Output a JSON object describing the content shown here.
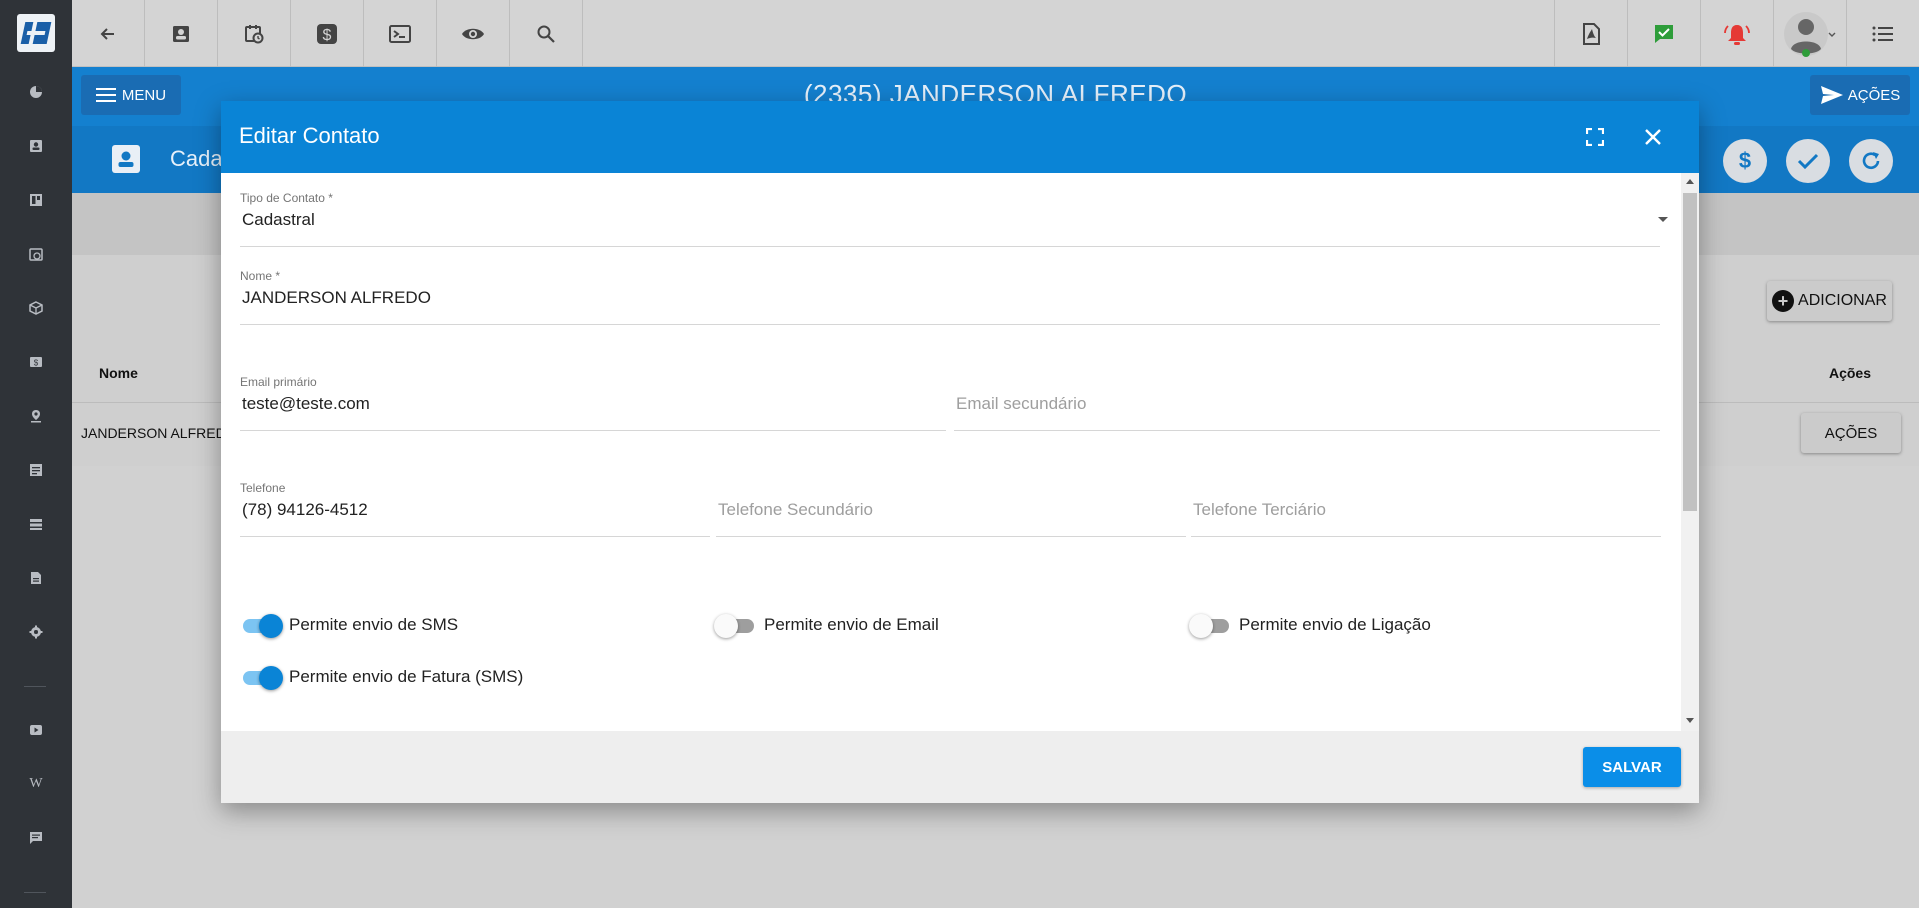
{
  "sidebar": {
    "icons": [
      "dashboard-icon",
      "contact-card-icon",
      "board-icon",
      "schedule-icon",
      "box-icon",
      "money-icon",
      "map-pin-icon",
      "list-icon",
      "server-icon",
      "document-icon",
      "settings-icon",
      "video-icon",
      "wiki-icon",
      "message-icon"
    ]
  },
  "topbar": {
    "left_icons": [
      "back-arrow-icon",
      "contact-card-icon",
      "schedule-icon",
      "dollar-icon",
      "terminal-icon",
      "eye-icon",
      "search-icon"
    ],
    "right_icons": [
      "pdf-icon",
      "check-chat-icon",
      "alarm-bell-icon",
      "user-avatar-icon",
      "list-menu-icon"
    ]
  },
  "header": {
    "menu_label": "MENU",
    "title": "(2335) JANDERSON ALFREDO",
    "acoes_label": "AÇÕES",
    "section_label": "Cada",
    "wiki_letter": "W"
  },
  "content": {
    "add_label": "ADICIONAR",
    "col_nome": "Nome",
    "col_acoes": "Ações",
    "row_nome": "JANDERSON ALFREDO",
    "row_acoes": "AÇÕES"
  },
  "modal": {
    "title": "Editar Contato",
    "tipo_label": "Tipo de Contato *",
    "tipo_value": "Cadastral",
    "nome_label": "Nome *",
    "nome_value": "JANDERSON ALFREDO",
    "email1_label": "Email primário",
    "email1_value": "teste@teste.com",
    "email2_placeholder": "Email secundário",
    "tel1_label": "Telefone",
    "tel1_value": "(78) 94126-4512",
    "tel2_placeholder": "Telefone Secundário",
    "tel3_placeholder": "Telefone Terciário",
    "toggles": [
      {
        "label": "Permite envio de SMS",
        "on": true
      },
      {
        "label": "Permite envio de Email",
        "on": false
      },
      {
        "label": "Permite envio de Ligação",
        "on": false
      },
      {
        "label": "Permite envio de Fatura (SMS)",
        "on": true
      }
    ],
    "save_label": "SALVAR"
  },
  "colors": {
    "primary": "#0a84d6",
    "header_blue": "#1480cf",
    "sidebar": "#2f3338",
    "alert_red": "#e53935",
    "check_green": "#2e9d3a"
  }
}
